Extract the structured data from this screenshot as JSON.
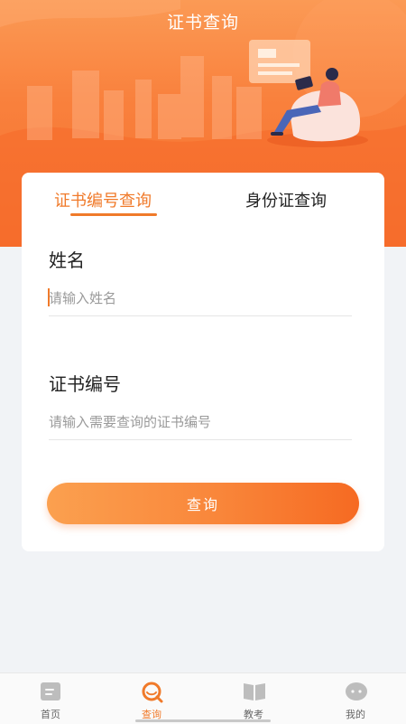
{
  "header": {
    "title": "证书查询"
  },
  "tabs": [
    {
      "label": "证书编号查询",
      "active": true
    },
    {
      "label": "身份证查询",
      "active": false
    }
  ],
  "form": {
    "name": {
      "label": "姓名",
      "value": "",
      "placeholder": "请输入姓名"
    },
    "cert_no": {
      "label": "证书编号",
      "value": "",
      "placeholder": "请输入需要查询的证书编号"
    },
    "submit_label": "查询"
  },
  "tabbar": {
    "items": [
      {
        "label": "首页",
        "icon": "document-icon",
        "active": false
      },
      {
        "label": "查询",
        "icon": "search-icon",
        "active": true
      },
      {
        "label": "教考",
        "icon": "book-icon",
        "active": false
      },
      {
        "label": "我的",
        "icon": "chat-bubble-icon",
        "active": false
      }
    ]
  },
  "colors": {
    "accent": "#f07a2a",
    "hero": "#f9813d",
    "background": "#f1f3f6"
  }
}
